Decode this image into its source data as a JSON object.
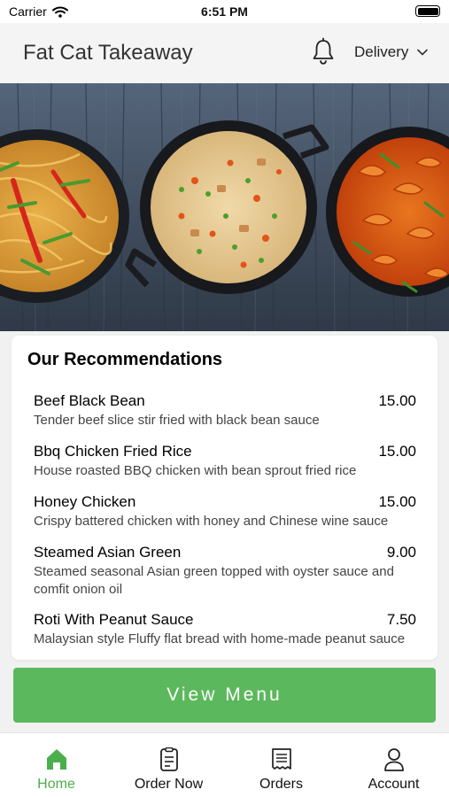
{
  "status_bar": {
    "carrier": "Carrier",
    "time": "6:51 PM",
    "icons": [
      "wifi-icon",
      "battery-icon"
    ]
  },
  "header": {
    "title": "Fat Cat Takeaway",
    "bell_icon": "bell-icon",
    "delivery_label": "Delivery",
    "dropdown_icon": "chevron-down-icon"
  },
  "hero": {
    "dishes": [
      "noodles",
      "fried-rice",
      "chilli-prawns"
    ]
  },
  "recommendations": {
    "title": "Our Recommendations",
    "items": [
      {
        "name": "Beef Black Bean",
        "price": "15.00",
        "description": "Tender beef slice stir fried with black bean sauce"
      },
      {
        "name": "Bbq Chicken Fried Rice",
        "price": "15.00",
        "description": "House roasted BBQ chicken with bean sprout fried rice"
      },
      {
        "name": "Honey Chicken",
        "price": "15.00",
        "description": "Crispy battered chicken with honey and Chinese wine sauce"
      },
      {
        "name": "Steamed Asian Green",
        "price": "9.00",
        "description": "Steamed seasonal Asian green topped with oyster sauce and comfit onion oil"
      },
      {
        "name": "Roti With Peanut Sauce",
        "price": "7.50",
        "description": "Malaysian style Fluffy flat bread with home-made peanut sauce"
      }
    ]
  },
  "view_menu_label": "View Menu",
  "tabs": [
    {
      "label": "Home",
      "icon": "home-icon",
      "active": true
    },
    {
      "label": "Order Now",
      "icon": "order-icon",
      "active": false
    },
    {
      "label": "Orders",
      "icon": "receipt-icon",
      "active": false
    },
    {
      "label": "Account",
      "icon": "account-icon",
      "active": false
    }
  ],
  "colors": {
    "accent": "#5cb85c",
    "active_tab": "#4cae4c",
    "header_bg": "#f4f4f4"
  }
}
